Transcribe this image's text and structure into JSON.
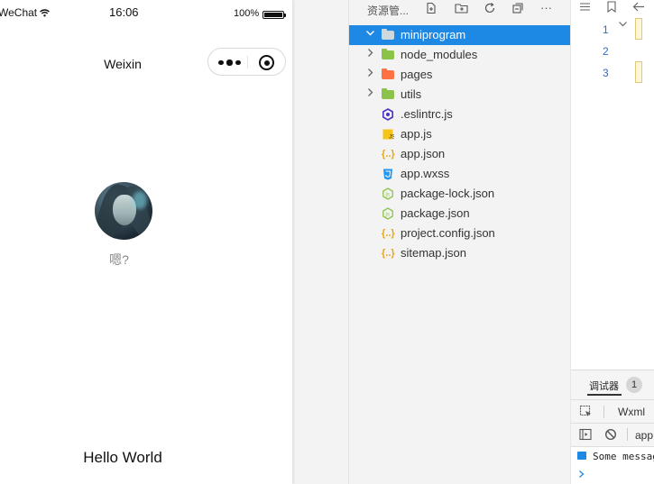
{
  "phone": {
    "carrier": "WeChat",
    "time": "16:06",
    "battery": "100%",
    "nav_title": "Weixin",
    "nickname": "嗯?",
    "hello": "Hello World"
  },
  "explorer": {
    "title": "资源管...",
    "items": [
      {
        "label": "miniprogram",
        "icon": "folder-icon",
        "color": "#9aa0a6"
      },
      {
        "label": "node_modules",
        "icon": "node-folder-icon",
        "color": "#8bc34a"
      },
      {
        "label": "pages",
        "icon": "pages-folder-icon",
        "color": "#ff7043"
      },
      {
        "label": "utils",
        "icon": "utils-folder-icon",
        "color": "#8bc34a"
      },
      {
        "label": ".eslintrc.js",
        "icon": "eslint-icon",
        "color": "#4b32c3"
      },
      {
        "label": "app.js",
        "icon": "js-file-icon",
        "color": "#f5c518"
      },
      {
        "label": "app.json",
        "icon": "json-file-icon",
        "color": "#f0a30a"
      },
      {
        "label": "app.wxss",
        "icon": "css-file-icon",
        "color": "#2196f3"
      },
      {
        "label": "package-lock.json",
        "icon": "npm-file-icon",
        "color": "#8bc34a"
      },
      {
        "label": "package.json",
        "icon": "npm-file-icon",
        "color": "#8bc34a"
      },
      {
        "label": "project.config.json",
        "icon": "json-file-icon",
        "color": "#f0a30a"
      },
      {
        "label": "sitemap.json",
        "icon": "json-file-icon",
        "color": "#f0a30a"
      }
    ]
  },
  "editor": {
    "line_numbers": [
      "1",
      "2",
      "3"
    ]
  },
  "debug": {
    "tab": "调试器",
    "badge": "1",
    "wxml_tab": "Wxml",
    "context": "app",
    "message": "Some messag"
  },
  "colors": {
    "selection": "#1e88e5",
    "line_number": "#2b6ccf"
  }
}
